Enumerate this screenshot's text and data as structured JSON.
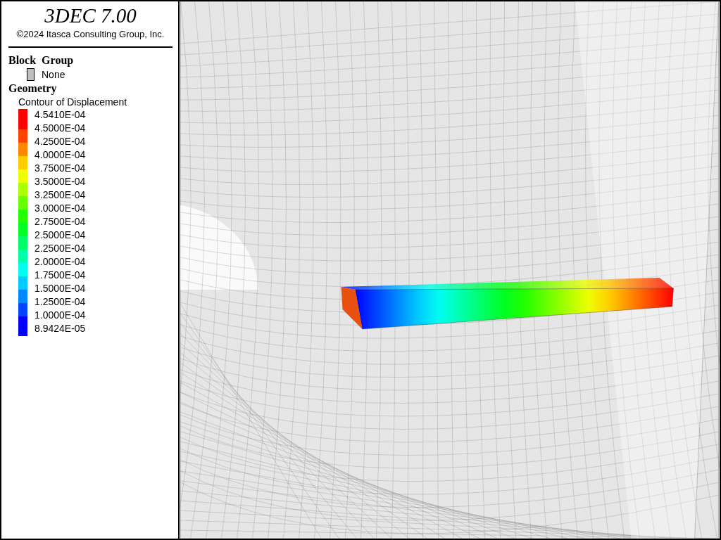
{
  "title": "3DEC 7.00",
  "copyright": "©2024 Itasca Consulting Group, Inc.",
  "block_group": {
    "heading": "Block  Group",
    "items": [
      {
        "label": "None",
        "color": "#c0c0c0"
      }
    ]
  },
  "geometry": {
    "heading": "Geometry"
  },
  "contour": {
    "title": "Contour of Displacement",
    "bands": [
      {
        "color": "#ff0000"
      },
      {
        "color": "#ff4400"
      },
      {
        "color": "#ff8800"
      },
      {
        "color": "#ffcc00"
      },
      {
        "color": "#eeff00"
      },
      {
        "color": "#aaff00"
      },
      {
        "color": "#66ff00"
      },
      {
        "color": "#22ff00"
      },
      {
        "color": "#00ff22"
      },
      {
        "color": "#00ff66"
      },
      {
        "color": "#00ffaa"
      },
      {
        "color": "#00ffee"
      },
      {
        "color": "#00ccff"
      },
      {
        "color": "#0088ff"
      },
      {
        "color": "#0044ff"
      },
      {
        "color": "#0000ff"
      }
    ],
    "labels": [
      "4.5410E-04",
      "4.5000E-04",
      "4.2500E-04",
      "4.0000E-04",
      "3.7500E-04",
      "3.5000E-04",
      "3.2500E-04",
      "3.0000E-04",
      "2.7500E-04",
      "2.5000E-04",
      "2.2500E-04",
      "2.0000E-04",
      "1.7500E-04",
      "1.5000E-04",
      "1.2500E-04",
      "1.0000E-04",
      "8.9424E-05"
    ]
  }
}
